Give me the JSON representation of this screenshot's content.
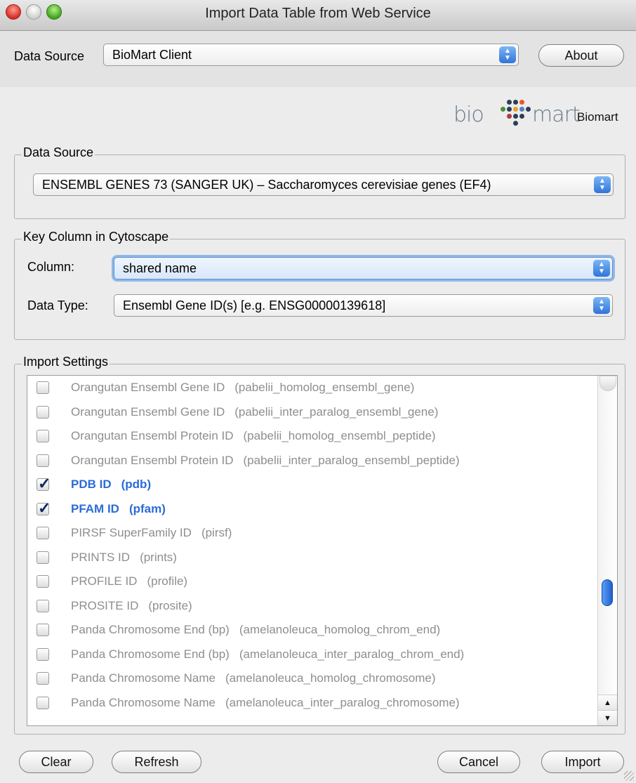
{
  "window": {
    "title": "Import Data Table from Web Service"
  },
  "top": {
    "data_source_label": "Data Source",
    "data_source_value": "BioMart Client",
    "about_button": "About"
  },
  "logo": {
    "bio": "bio",
    "mart": "mart",
    "label": "Biomart",
    "dot_colors": [
      "#2a3f5a",
      "#2a3f5a",
      "#e85a2b",
      "#4d8f3c",
      "#2a3f5a",
      "#e8a12b",
      "#5a7fbf",
      "#2a3f5a",
      "#b23a3a",
      "#2a3f5a",
      "#2a3f5a",
      "#2a3f5a"
    ]
  },
  "data_source_group": {
    "title": "Data Source",
    "value": "ENSEMBL GENES 73 (SANGER UK) – Saccharomyces cerevisiae genes (EF4)"
  },
  "key_column_group": {
    "title": "Key Column in Cytoscape",
    "column_label": "Column:",
    "column_value": "shared name",
    "data_type_label": "Data Type:",
    "data_type_value": "Ensembl Gene ID(s) [e.g. ENSG00000139618]"
  },
  "import_settings": {
    "title": "Import Settings",
    "items": [
      {
        "label": "Orangutan Ensembl Gene ID",
        "code": "(pabelii_homolog_ensembl_gene)",
        "checked": false
      },
      {
        "label": "Orangutan Ensembl Gene ID",
        "code": "(pabelii_inter_paralog_ensembl_gene)",
        "checked": false
      },
      {
        "label": "Orangutan Ensembl Protein ID",
        "code": "(pabelii_homolog_ensembl_peptide)",
        "checked": false
      },
      {
        "label": "Orangutan Ensembl Protein ID",
        "code": "(pabelii_inter_paralog_ensembl_peptide)",
        "checked": false
      },
      {
        "label": "PDB ID",
        "code": "(pdb)",
        "checked": true
      },
      {
        "label": "PFAM ID",
        "code": "(pfam)",
        "checked": true
      },
      {
        "label": "PIRSF SuperFamily ID",
        "code": "(pirsf)",
        "checked": false
      },
      {
        "label": "PRINTS ID",
        "code": "(prints)",
        "checked": false
      },
      {
        "label": "PROFILE ID",
        "code": "(profile)",
        "checked": false
      },
      {
        "label": "PROSITE ID",
        "code": "(prosite)",
        "checked": false
      },
      {
        "label": "Panda Chromosome End (bp)",
        "code": "(amelanoleuca_homolog_chrom_end)",
        "checked": false
      },
      {
        "label": "Panda Chromosome End (bp)",
        "code": "(amelanoleuca_inter_paralog_chrom_end)",
        "checked": false
      },
      {
        "label": "Panda Chromosome Name",
        "code": "(amelanoleuca_homolog_chromosome)",
        "checked": false
      },
      {
        "label": "Panda Chromosome Name",
        "code": "(amelanoleuca_inter_paralog_chromosome)",
        "checked": false
      }
    ]
  },
  "buttons": {
    "clear": "Clear",
    "refresh": "Refresh",
    "cancel": "Cancel",
    "import": "Import"
  }
}
